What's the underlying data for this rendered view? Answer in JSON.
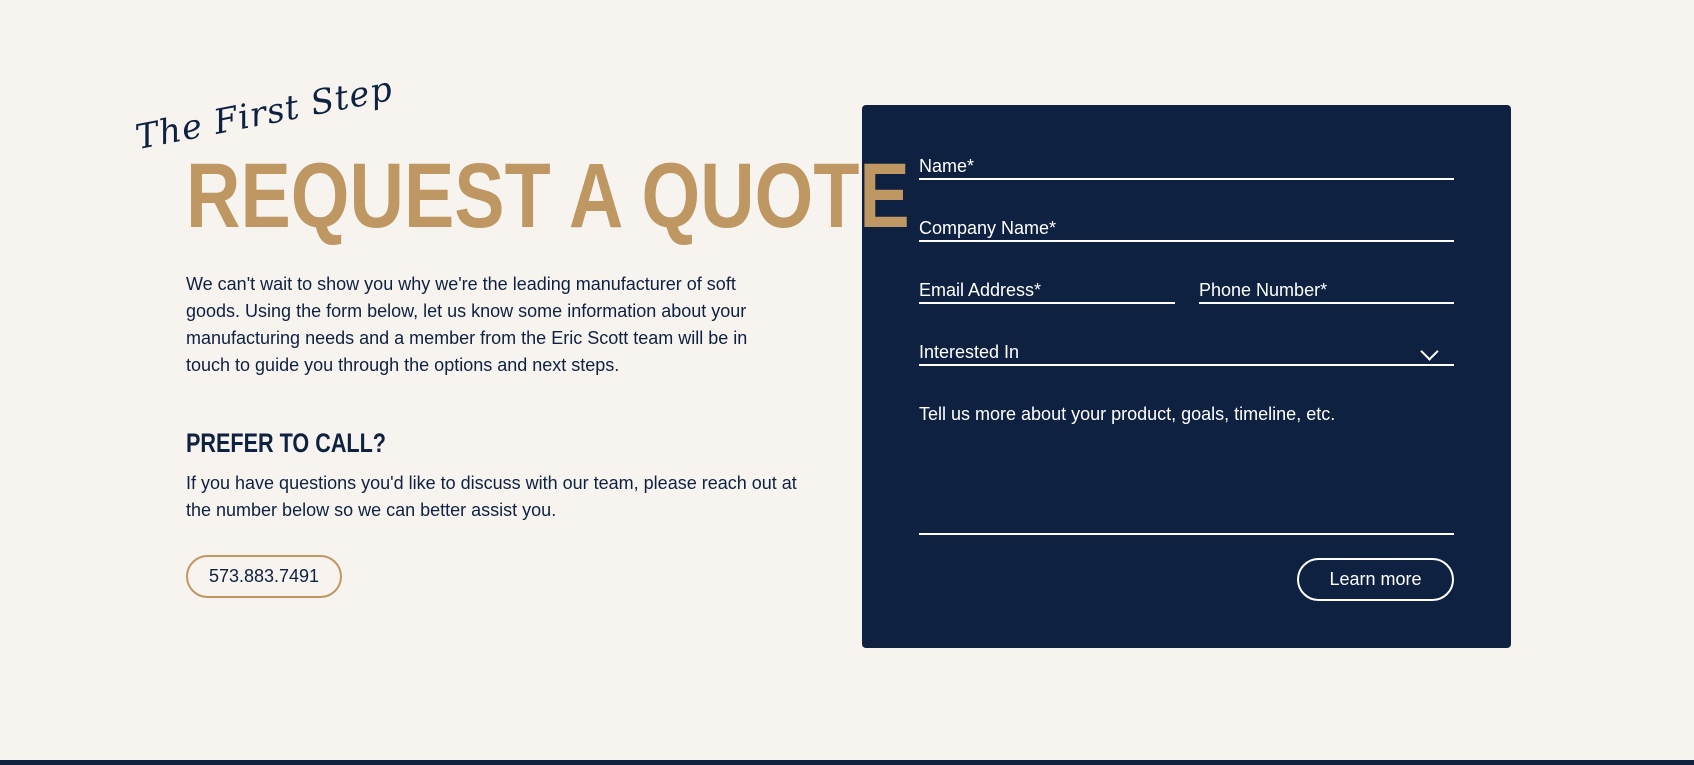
{
  "hero": {
    "script_label": "The First Step",
    "headline": "REQUEST A QUOTE",
    "intro": "We can't wait to show you why we're the leading manufacturer of soft goods. Using the form below, let us know some information about your manufacturing needs and a member from the Eric Scott team will be in touch to guide you through the options and next steps."
  },
  "call": {
    "heading": "PREFER TO CALL?",
    "text": "If you have questions you'd like to discuss with our team, please reach out at the number below so we can better assist you.",
    "phone": "573.883.7491"
  },
  "form": {
    "name_label": "Name*",
    "company_label": "Company Name*",
    "email_label": "Email Address*",
    "phone_label": "Phone Number*",
    "interest_label": "Interested In",
    "message_label": "Tell us more about your product, goals, timeline, etc.",
    "submit_label": "Learn more"
  },
  "colors": {
    "background": "#f7f3ef",
    "navy": "#0e2140",
    "gold": "#bf9763",
    "white": "#ffffff"
  },
  "icons": {
    "dropdown": "chevron-down-icon"
  }
}
